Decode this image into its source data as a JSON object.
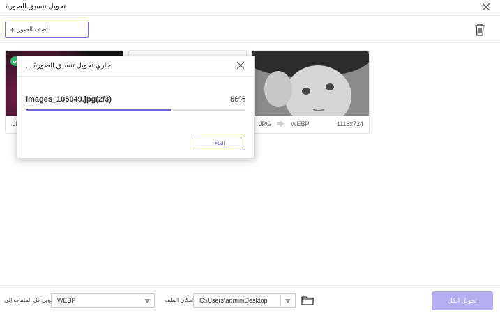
{
  "window": {
    "title": "تحويل تنسيق الصورة"
  },
  "toolbar": {
    "add_images_label": "أضف الصور",
    "add_icon": "plus-icon",
    "delete_icon": "trash-icon"
  },
  "cards": [
    {
      "status_icon": "check-circle-icon",
      "status_color": "#2fbf71",
      "source_format": "JPG"
    },
    {},
    {
      "source_format": "JPG",
      "target_format": "WEBP",
      "dimensions": "1116x724"
    }
  ],
  "dialog": {
    "title": "جاري تحويل تنسيق الصورة ...",
    "file_name": "images_105049.jpg(2/3)",
    "percent_text": "66%",
    "progress": 0.66,
    "cancel_label": "إلغاء",
    "accent_color": "#6f63d6"
  },
  "footer": {
    "convert_all_to_label": "تحويل كل الملفات إلى:",
    "format_value": "WEBP",
    "file_location_label": "مكان الملف:",
    "path_value": "C:\\Users\\admin\\Desktop",
    "folder_icon": "folder-icon",
    "convert_all_button": "تحويل الكل",
    "convert_button_color": "#b4aef0"
  }
}
